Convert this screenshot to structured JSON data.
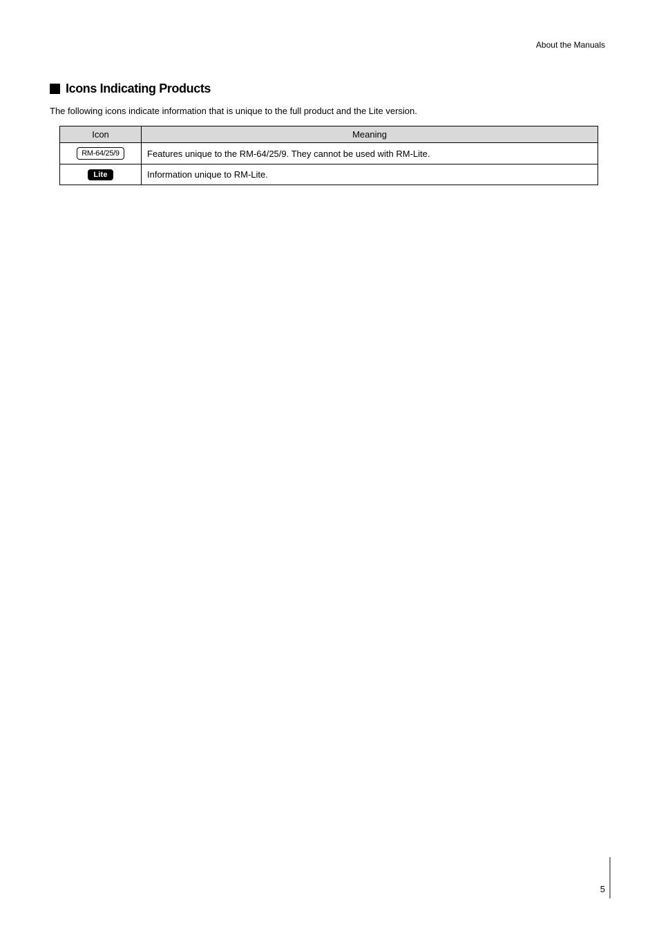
{
  "header": {
    "running_head": "About the Manuals"
  },
  "section": {
    "title": "Icons Indicating Products",
    "intro": "The following icons indicate information that is unique to the full product and the Lite version."
  },
  "table": {
    "headers": {
      "icon": "Icon",
      "meaning": "Meaning"
    },
    "rows": [
      {
        "icon_label": "RM-64/25/9",
        "icon_style": "outline",
        "meaning": "Features unique to the RM-64/25/9. They cannot be used with RM-Lite."
      },
      {
        "icon_label": "Lite",
        "icon_style": "solid",
        "meaning": "Information unique to RM-Lite."
      }
    ]
  },
  "footer": {
    "page_number": "5"
  }
}
